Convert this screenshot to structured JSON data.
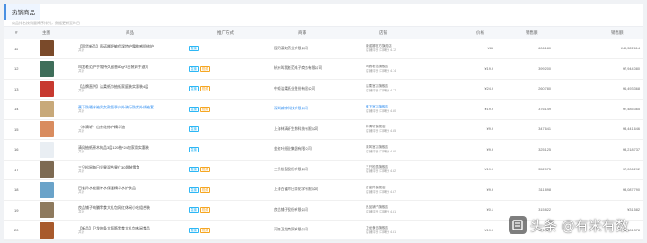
{
  "page": {
    "tab_label": "热销商品",
    "subtitle": "商品排名按销量降序排列，数据更新至昨日"
  },
  "table": {
    "headers": {
      "rank": "#",
      "thumb": "主图",
      "goods": "商品",
      "promo": "推广方式",
      "shop": "商家",
      "store": "店铺",
      "price": "价格",
      "sales": "销售额",
      "amount": "销售额"
    },
    "rows": [
      {
        "rank": "11",
        "thumb_color": "#7a4a2a",
        "title": "【国货新品】薇诺娜舒敏保湿特护霜敏感肌修护",
        "sub": "共计",
        "tags": [
          "直播"
        ],
        "shop": "昆明滇虹药业有限公司",
        "store_name": "薇诺娜官方旗舰店",
        "store_score": "店铺评分 口碑分 4.72",
        "price": "¥85",
        "sales": "606,180",
        "amount": "¥40,322,614",
        "title_link": false,
        "shop_link": false,
        "store_link": false
      },
      {
        "rank": "12",
        "thumb_color": "#3f6e5a",
        "title": "叫我老范护手霜持久留香80g*3支装润手滋润",
        "sub": "共计",
        "tags": [
          "直播",
          "视频"
        ],
        "shop": "杭州叫我老范电子商务有限公司",
        "store_name": "叫我老范旗舰店",
        "store_score": "店铺评分 口碑分 4.74",
        "price": "¥19.9",
        "sales": "399,200",
        "amount": "¥7,944,080",
        "title_link": false,
        "shop_link": false,
        "store_link": false
      },
      {
        "rank": "13",
        "thumb_color": "#c7392f",
        "title": "【品牌直供】洁柔纸巾抽纸家庭装实惠装4层",
        "sub": "共计",
        "tags": [
          "直播",
          "视频"
        ],
        "shop": "中顺洁柔纸业股份有限公司",
        "store_name": "洁柔官方旗舰店",
        "store_score": "店铺评分 口碑分 4.77",
        "price": "¥24.9",
        "sales": "260,780",
        "amount": "¥6,493,368",
        "title_link": false,
        "shop_link": false,
        "store_link": false
      },
      {
        "rank": "14",
        "thumb_color": "#c8a97a",
        "title": "蕉下防晒冰袖男女款夏季户外骑行防紫外线袖套",
        "sub": "共计",
        "tags": [
          "直播",
          "视频"
        ],
        "shop": "深圳减字科技有限公司",
        "store_name": "蕉下官方旗舰店",
        "store_score": "店铺评分 口碑分 4.80",
        "price": "¥19.9",
        "sales": "376,149",
        "amount": "¥7,485,365",
        "title_link": true,
        "shop_link": true,
        "store_link": true
      },
      {
        "rank": "15",
        "thumb_color": "#d98c5f",
        "title": "（林清轩）山茶花修护精华油",
        "sub": "共计",
        "tags": [
          "直播"
        ],
        "shop": "上海林清轩生物科技有限公司",
        "store_name": "林清轩旗舰店",
        "store_score": "店铺评分 口碑分 4.85",
        "price": "¥9.9",
        "sales": "347,641",
        "amount": "¥3,441,646",
        "title_link": false,
        "shop_link": false,
        "store_link": false
      },
      {
        "rank": "16",
        "thumb_color": "#e9eef3",
        "title": "清风抽纸原木纯品3层120抽*24包家用实惠装",
        "sub": "共计",
        "tags": [
          "直播"
        ],
        "shop": "金红叶纸业集团有限公司",
        "store_name": "清风官方旗舰店",
        "store_score": "店铺评分 口碑分 4.80",
        "price": "¥9.9",
        "sales": "325,125",
        "amount": "¥3,218,737",
        "title_link": false,
        "shop_link": false,
        "store_link": false
      },
      {
        "rank": "17",
        "thumb_color": "#7d6a52",
        "title": "三只松鼠每日坚果混合果仁30袋装零食",
        "sub": "共计",
        "tags": [
          "直播",
          "视频"
        ],
        "shop": "三只松鼠股份有限公司",
        "store_name": "三只松鼠旗舰店",
        "store_score": "店铺评分 口碑分 4.82",
        "price": "¥19.9",
        "sales": "352,075",
        "amount": "¥7,006,292",
        "title_link": false,
        "shop_link": false,
        "store_link": false
      },
      {
        "rank": "18",
        "thumb_color": "#6aa3c9",
        "title": "百雀羚水能量补水保湿精华水护肤品",
        "sub": "共计",
        "tags": [
          "直播",
          "视频"
        ],
        "shop": "上海百雀羚日用化学有限公司",
        "store_name": "百雀羚旗舰店",
        "store_score": "店铺评分 口碑分 4.87",
        "price": "¥9.9",
        "sales": "311,898",
        "amount": "¥3,087,790",
        "title_link": false,
        "shop_link": false,
        "store_link": false
      },
      {
        "rank": "19",
        "thumb_color": "#8e7a5e",
        "title": "良品铺子肉脯零食大礼包网红休闲小吃组合装",
        "sub": "共计",
        "tags": [
          "直播",
          "视频"
        ],
        "shop": "良品铺子股份有限公司",
        "store_name": "良品铺子旗舰店",
        "store_score": "店铺评分 口碑分 4.81",
        "price": "¥0.1",
        "sales": "315,822",
        "amount": "¥31,582",
        "title_link": false,
        "shop_link": false,
        "store_link": false
      },
      {
        "rank": "20",
        "thumb_color": "#a85a2c",
        "title": "【新品】卫龙辣条大面筋零食大礼包休闲食品",
        "sub": "共计",
        "tags": [
          "直播",
          "视频"
        ],
        "shop": "河南卫龙商贸有限公司",
        "store_name": "卫龙食品旗舰店",
        "store_score": "店铺评分 口碑分 4.81",
        "price": "¥19.9",
        "sales": "310,622",
        "amount": "¥6,181,378",
        "title_link": false,
        "shop_link": false,
        "store_link": false
      }
    ]
  },
  "watermark": {
    "text": "头条 @有米有数",
    "logo_icon": "toutiao-logo-icon"
  },
  "colors": {
    "accent": "#4a90e2",
    "link": "#2d8cf0",
    "tag_live": "#2db7f5",
    "tag_video": "#f5a623"
  }
}
